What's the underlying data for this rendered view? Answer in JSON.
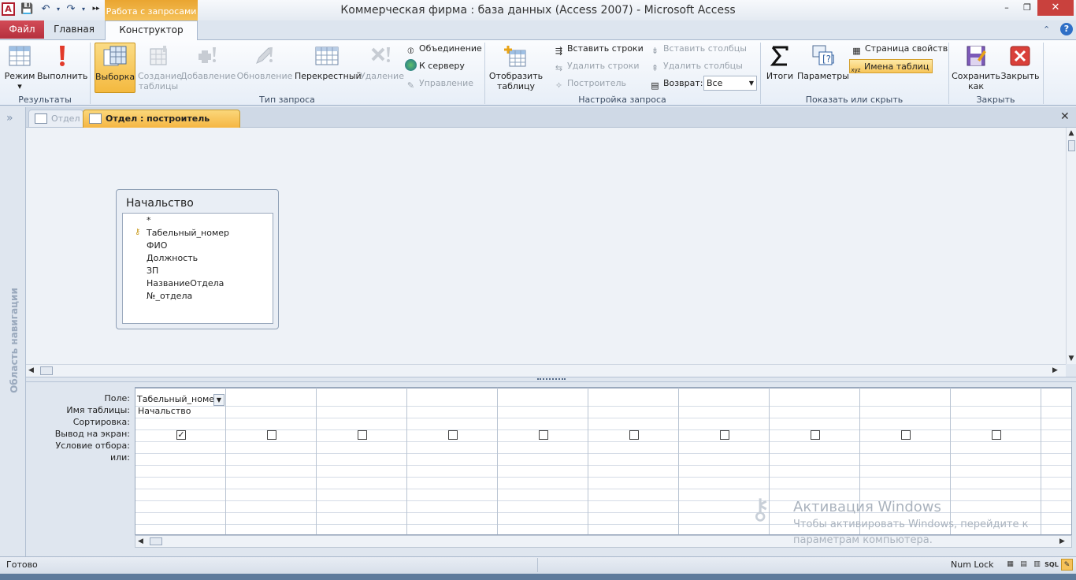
{
  "window": {
    "app_icon_letter": "A",
    "title": "Коммерческая фирма : база данных (Access 2007)  -  Microsoft Access",
    "context_tab_group": "Работа с запросами",
    "controls": {
      "minimize": "–",
      "maximize": "❐",
      "close": "✕"
    }
  },
  "quick_access": {
    "save": "💾",
    "undo": "↶",
    "redo": "↷",
    "more": "▸▸"
  },
  "tabs": {
    "file": "Файл",
    "home": "Главная",
    "constructor": "Конструктор"
  },
  "ribbon": {
    "minimize": "⌃",
    "help": "?",
    "groups": {
      "results": {
        "label": "Результаты",
        "mode": "Режим",
        "mode_arrow": "▾",
        "run": "Выполнить"
      },
      "query_type": {
        "label": "Тип запроса",
        "select": "Выборка",
        "make_table_1": "Создание",
        "make_table_2": "таблицы",
        "append": "Добавление",
        "update": "Обновление",
        "crosstab": "Перекрестный",
        "delete": "Удаление",
        "union": "Объединение",
        "pass_through": "К серверу",
        "data_definition": "Управление"
      },
      "query_setup": {
        "label": "Настройка запроса",
        "show_table_1": "Отобразить",
        "show_table_2": "таблицу",
        "insert_rows": "Вставить строки",
        "delete_rows": "Удалить строки",
        "builder": "Построитель",
        "insert_columns": "Вставить столбцы",
        "delete_columns": "Удалить столбцы",
        "return_label": "Возврат:",
        "return_value": "Все"
      },
      "show_hide": {
        "label": "Показать или скрыть",
        "totals": "Итоги",
        "parameters": "Параметры",
        "property_sheet": "Страница свойств",
        "table_names": "Имена таблиц"
      },
      "close": {
        "label": "Закрыть",
        "save_as_1": "Сохранить",
        "save_as_2": "как",
        "close": "Закрыть"
      }
    }
  },
  "navigation": {
    "toggle": "»",
    "title": "Область навигации"
  },
  "doc_tabs": [
    {
      "label": "Отдел",
      "active": false
    },
    {
      "label": "Отдел : построитель запросов",
      "active": true
    }
  ],
  "doc_close": "✕",
  "table": {
    "title": "Начальство",
    "fields": [
      "*",
      "Табельный_номер",
      "ФИО",
      "Должность",
      "ЗП",
      "НазваниеОтдела",
      "№_отдела"
    ],
    "key_field_index": 1
  },
  "grid": {
    "row_labels": [
      "Поле:",
      "Имя таблицы:",
      "Сортировка:",
      "Вывод на экран:",
      "Условие отбора:",
      "или:"
    ],
    "first_column": {
      "field": "Табельный_номер",
      "table": "Начальство",
      "show": true
    },
    "column_count": 10
  },
  "watermark": {
    "title": "Активация Windows",
    "text": "Чтобы активировать Windows, перейдите к параметрам компьютера."
  },
  "status": {
    "ready": "Готово",
    "numlock": "Num Lock",
    "sql": "SQL"
  }
}
